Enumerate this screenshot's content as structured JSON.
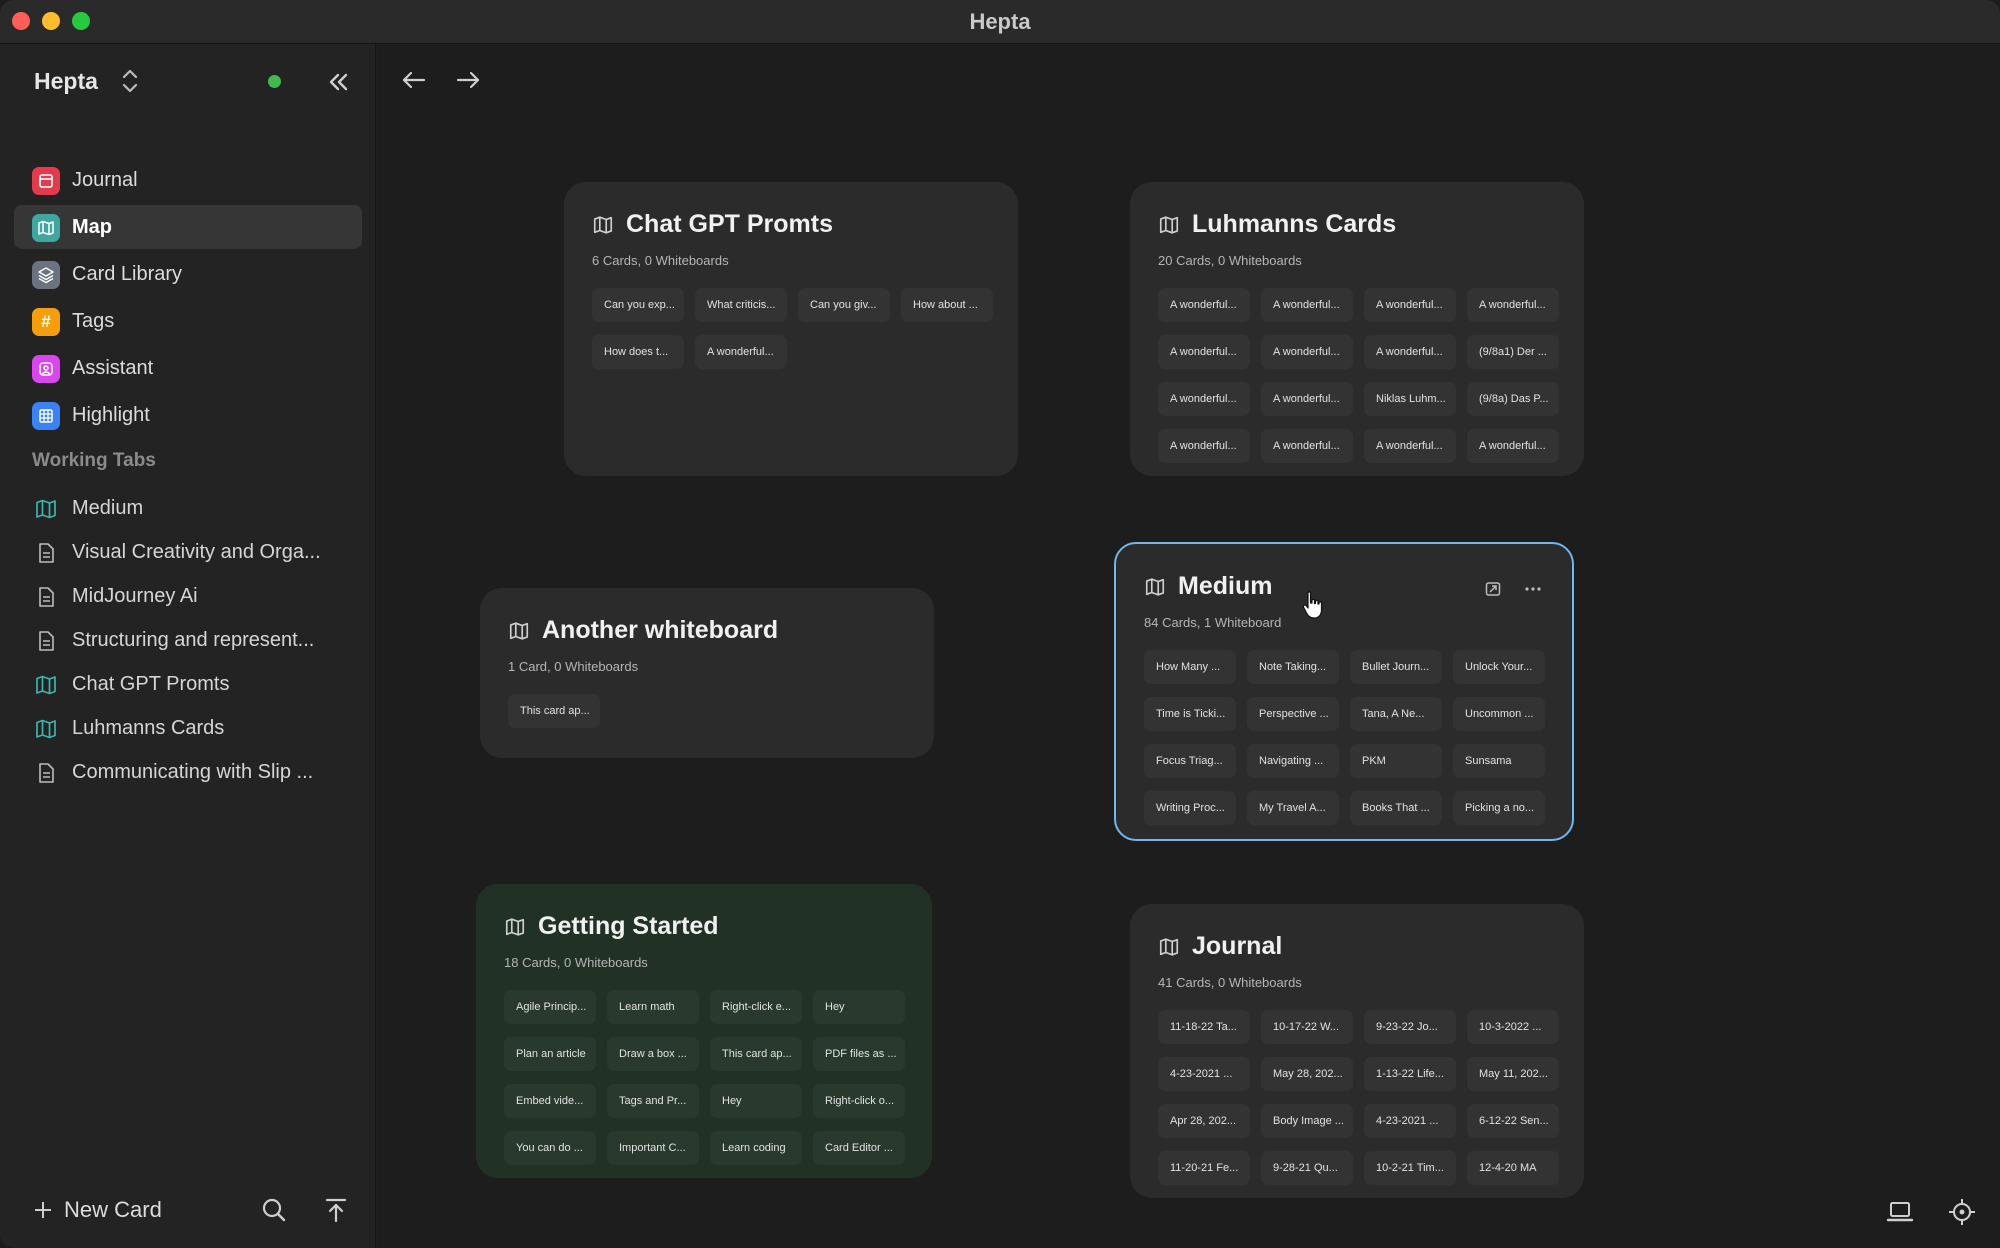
{
  "window": {
    "title": "Hepta"
  },
  "sidebar": {
    "workspace": "Hepta",
    "nav": [
      {
        "label": "Journal",
        "icon": "journal-icon",
        "color": "#e23b4e"
      },
      {
        "label": "Map",
        "icon": "map-icon",
        "color": "#3fa7a0"
      },
      {
        "label": "Card Library",
        "icon": "layers-icon",
        "color": "#6b7280"
      },
      {
        "label": "Tags",
        "icon": "hash-icon",
        "color": "#f59e0b"
      },
      {
        "label": "Assistant",
        "icon": "assistant-icon",
        "color": "#d946ef"
      },
      {
        "label": "Highlight",
        "icon": "highlight-icon",
        "color": "#3b82f6"
      }
    ],
    "working_tabs_title": "Working Tabs",
    "working_tabs": [
      {
        "label": "Medium",
        "icon": "map-icon"
      },
      {
        "label": "Visual Creativity and Orga...",
        "icon": "document-icon"
      },
      {
        "label": "MidJourney Ai",
        "icon": "document-icon"
      },
      {
        "label": "Structuring and represent...",
        "icon": "document-icon"
      },
      {
        "label": "Chat GPT Promts",
        "icon": "map-icon"
      },
      {
        "label": "Luhmanns Cards",
        "icon": "map-icon"
      },
      {
        "label": "Communicating with Slip ...",
        "icon": "document-icon"
      }
    ],
    "new_card_label": "New Card"
  },
  "whiteboards": [
    {
      "title": "Chat GPT Promts",
      "meta": "6 Cards, 0 Whiteboards",
      "cards": [
        "Can you exp...",
        "What criticis...",
        "Can you giv...",
        "How about ...",
        "How does t...",
        "A wonderful..."
      ]
    },
    {
      "title": "Luhmanns Cards",
      "meta": "20 Cards, 0 Whiteboards",
      "cards": [
        "A wonderful...",
        "A wonderful...",
        "A wonderful...",
        "A wonderful...",
        "A wonderful...",
        "A wonderful...",
        "A wonderful...",
        "(9/8a1) Der ...",
        "A wonderful...",
        "A wonderful...",
        "Niklas Luhm...",
        "(9/8a) Das P...",
        "A wonderful...",
        "A wonderful...",
        "A wonderful...",
        "A wonderful..."
      ]
    },
    {
      "title": "Another whiteboard",
      "meta": "1 Card, 0 Whiteboards",
      "cards": [
        "This card ap..."
      ]
    },
    {
      "title": "Medium",
      "meta": "84 Cards, 1 Whiteboard",
      "cards": [
        "How Many ...",
        "Note Taking...",
        "Bullet Journ...",
        "Unlock Your...",
        "Time is Ticki...",
        "Perspective ...",
        "Tana, A Ne...",
        "Uncommon ...",
        "Focus Triag...",
        "Navigating ...",
        "PKM",
        "Sunsama",
        "Writing Proc...",
        "My Travel A...",
        "Books That ...",
        "Picking a no..."
      ]
    },
    {
      "title": "Getting Started",
      "meta": "18 Cards, 0 Whiteboards",
      "cards": [
        "Agile Princip...",
        "Learn math",
        "Right-click e...",
        "Hey",
        "Plan an article",
        "Draw a box ...",
        "This card ap...",
        "PDF files as ...",
        "Embed vide...",
        "Tags and Pr...",
        "Hey",
        "Right-click o...",
        "You can do ...",
        "Important C...",
        "Learn coding",
        "Card Editor ..."
      ]
    },
    {
      "title": "Journal",
      "meta": "41 Cards, 0 Whiteboards",
      "cards": [
        "11-18-22 Ta...",
        "10-17-22 W...",
        "9-23-22 Jo...",
        "10-3-2022 ...",
        "4-23-2021 ...",
        "May 28, 202...",
        "1-13-22 Life...",
        "May 11, 202...",
        "Apr 28, 202...",
        "Body Image ...",
        "4-23-2021 ...",
        "6-12-22 Sen...",
        "11-20-21 Fe...",
        "9-28-21 Qu...",
        "10-2-21 Tim...",
        "12-4-20 MA"
      ]
    }
  ]
}
